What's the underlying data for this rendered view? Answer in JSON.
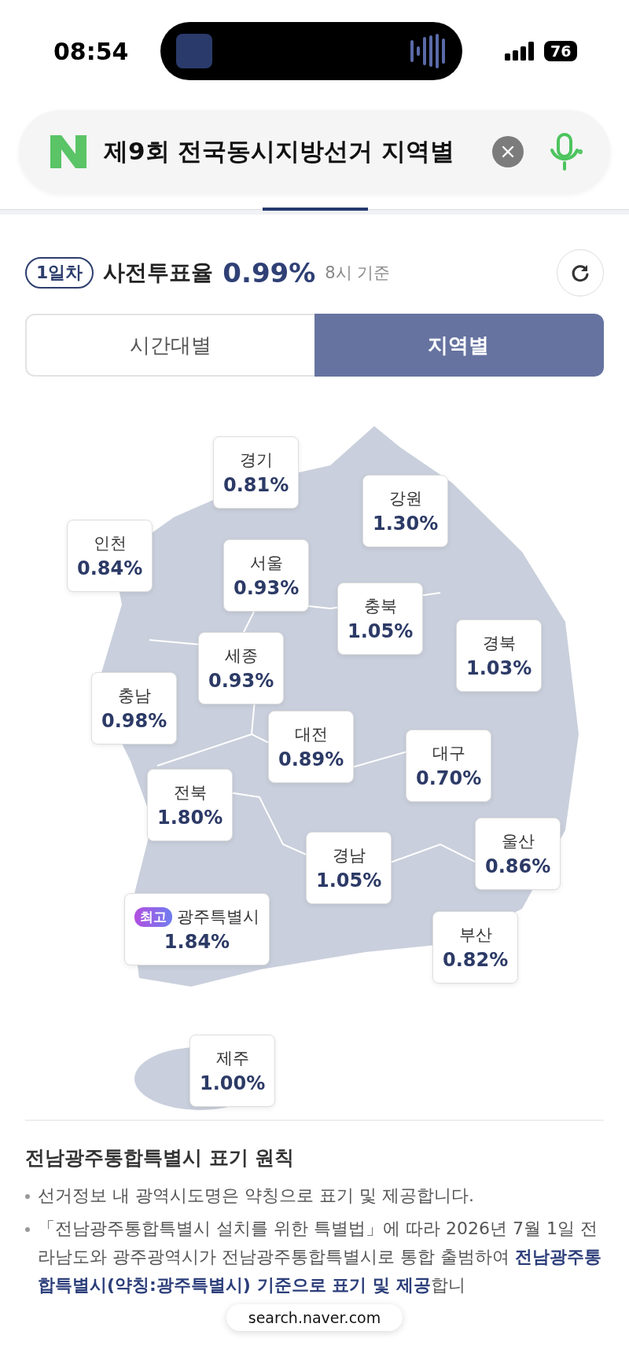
{
  "status_bar": {
    "time": "08:54",
    "battery": "76"
  },
  "search": {
    "value": "제9회 전국동시지방선거 지역별"
  },
  "summary": {
    "day_badge": "1일차",
    "label": "사전투표율",
    "rate": "0.99%",
    "basis": "8시 기준"
  },
  "tabs": [
    {
      "label": "시간대별",
      "selected": false
    },
    {
      "label": "지역별",
      "selected": true
    }
  ],
  "regions": [
    {
      "name": "경기",
      "rate": "0.81%"
    },
    {
      "name": "강원",
      "rate": "1.30%"
    },
    {
      "name": "인천",
      "rate": "0.84%"
    },
    {
      "name": "서울",
      "rate": "0.93%"
    },
    {
      "name": "충북",
      "rate": "1.05%"
    },
    {
      "name": "경북",
      "rate": "1.03%"
    },
    {
      "name": "세종",
      "rate": "0.93%"
    },
    {
      "name": "충남",
      "rate": "0.98%"
    },
    {
      "name": "대전",
      "rate": "0.89%"
    },
    {
      "name": "대구",
      "rate": "0.70%"
    },
    {
      "name": "전북",
      "rate": "1.80%"
    },
    {
      "name": "경남",
      "rate": "1.05%"
    },
    {
      "name": "울산",
      "rate": "0.86%"
    },
    {
      "name": "광주특별시",
      "rate": "1.84%",
      "badge": "최고"
    },
    {
      "name": "부산",
      "rate": "0.82%"
    },
    {
      "name": "제주",
      "rate": "1.00%"
    }
  ],
  "notice": {
    "title": "전남광주통합특별시 표기 원칙",
    "items": [
      "선거정보 내 광역시도명은 약칭으로 표기 및 제공합니다.",
      "「전남광주통합특별시 설치를 위한 특별법」에 따라 2026년 7월 1일 전라남도와 광주광역시가 전남광주통합특별시로 통합 출범하여 **전남광주통합특별시(약칭:광주특별시) 기준으로 표기 및 제공**합니"
    ]
  },
  "url_pill": "search.naver.com"
}
